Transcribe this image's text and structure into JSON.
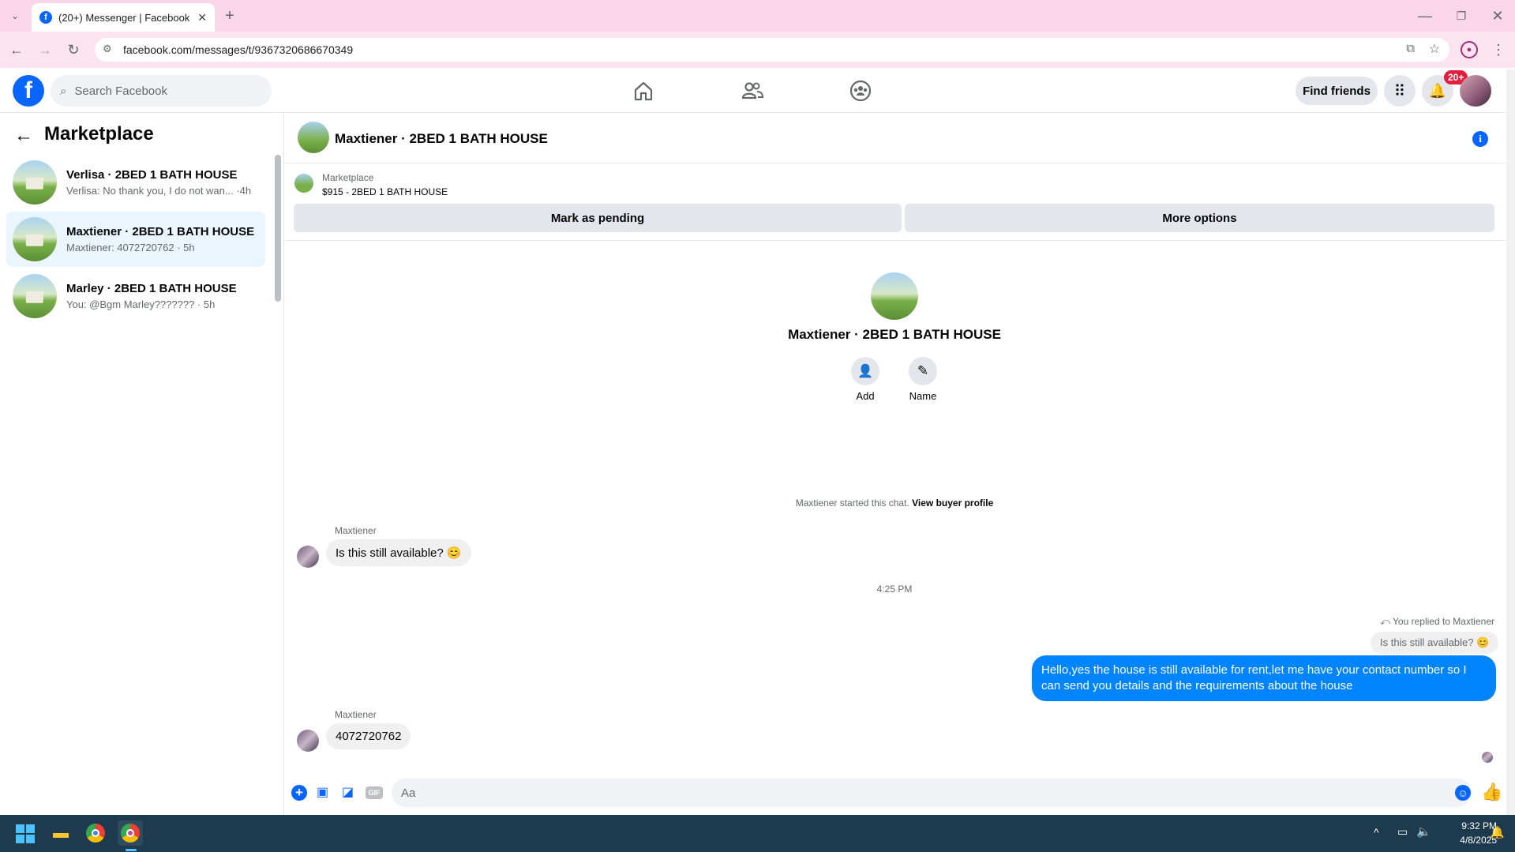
{
  "browser": {
    "tab_title": "(20+) Messenger | Facebook",
    "url": "facebook.com/messages/t/9367320686670349"
  },
  "fb_header": {
    "search_placeholder": "Search Facebook",
    "find_friends": "Find friends",
    "notif_badge": "20+"
  },
  "sidebar": {
    "title": "Marketplace",
    "conversations": [
      {
        "name": "Verlisa · 2BED 1 BATH HOUSE",
        "preview": "Verlisa: No thank you, I do not wan... ·4h"
      },
      {
        "name": "Maxtiener · 2BED 1 BATH HOUSE",
        "preview": "Maxtiener: 4072720762 · 5h"
      },
      {
        "name": "Marley · 2BED 1 BATH HOUSE",
        "preview": "You: @Bgm Marley??????? · 5h"
      }
    ]
  },
  "chat": {
    "header_title": "Maxtiener · 2BED 1 BATH HOUSE",
    "listing_label": "Marketplace",
    "listing_title": "$915 - 2BED 1 BATH HOUSE",
    "mark_pending": "Mark as pending",
    "more_options": "More options",
    "profile_name": "Maxtiener · 2BED 1 BATH HOUSE",
    "add_label": "Add",
    "name_label": "Name",
    "started_text": "Maxtiener started this chat.",
    "view_profile": "View buyer profile",
    "msg1_sender": "Maxtiener",
    "msg1_text": "Is this still available? 😊",
    "time_sep": "4:25 PM",
    "replied_to": "You replied to Maxtiener",
    "quoted": "Is this still available? 😊",
    "my_reply": "Hello,yes the house is still available for rent,let me have your contact number   so I can send you details and the requirements about the house",
    "msg2_sender": "Maxtiener",
    "msg2_text": "4072720762",
    "composer_placeholder": "Aa"
  },
  "taskbar": {
    "time": "9:32 PM",
    "date": "4/8/2025"
  },
  "colors": {
    "brand": "#0866ff",
    "bubble_out": "#0084ff",
    "tab_bar": "#f9d6e8"
  }
}
